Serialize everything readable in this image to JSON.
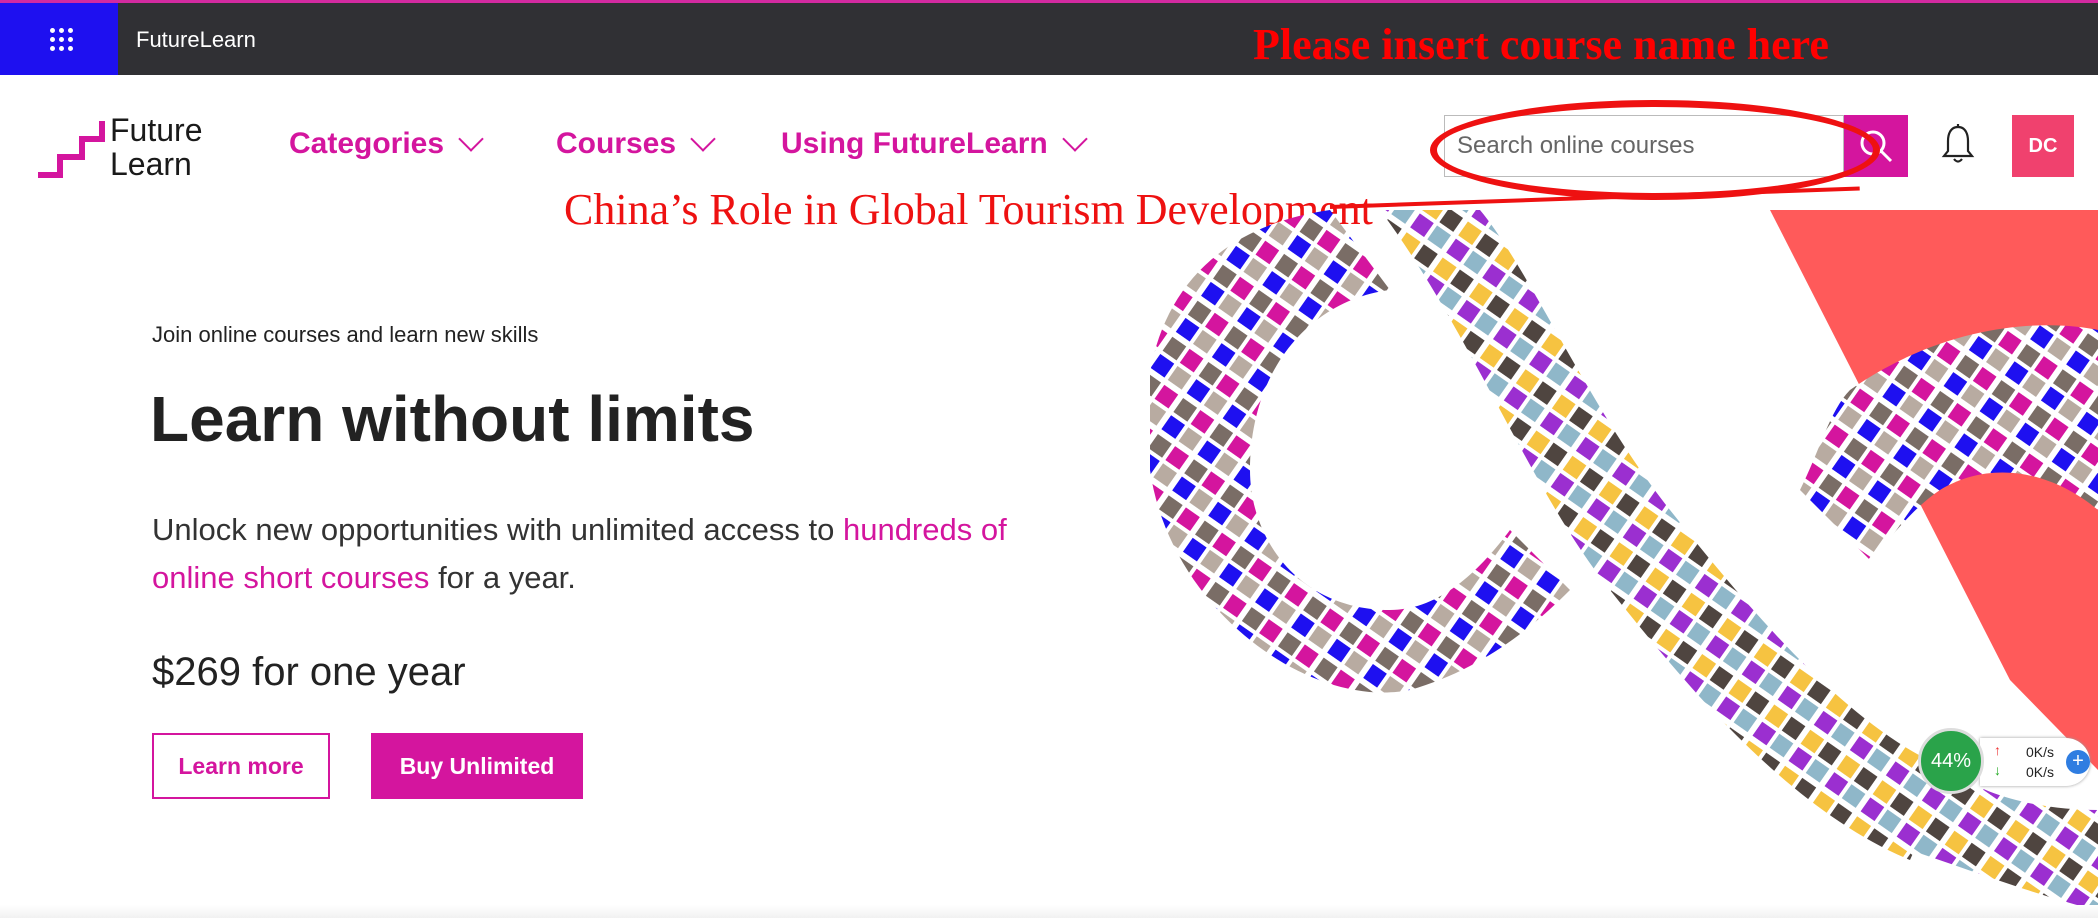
{
  "topbar": {
    "brand": "FutureLearn",
    "annotation": "Please insert course name here"
  },
  "nav": {
    "logo_line1": "Future",
    "logo_line2": "Learn",
    "links": [
      "Categories",
      "Courses",
      "Using FutureLearn"
    ],
    "search_placeholder": "Search online courses",
    "avatar_initials": "DC"
  },
  "annotation_course": "China’s Role in Global Tourism Development",
  "hero": {
    "eyebrow": "Join online courses and learn new skills",
    "headline": "Learn without limits",
    "body_prefix": "Unlock new opportunities with unlimited access to",
    "body_link": "hundreds of online short courses",
    "body_suffix": "for a year.",
    "price": "$269 for one year",
    "btn_learn_more": "Learn more",
    "btn_buy": "Buy Unlimited"
  },
  "tray": {
    "percent": "44%",
    "upload": "0K/s",
    "download": "0K/s"
  },
  "colors": {
    "brand_pink": "#d4159e",
    "topbar": "#303034",
    "waffle_blue": "#1e10f0",
    "annotation_red": "#ee1111",
    "avatar": "#f0416e"
  }
}
